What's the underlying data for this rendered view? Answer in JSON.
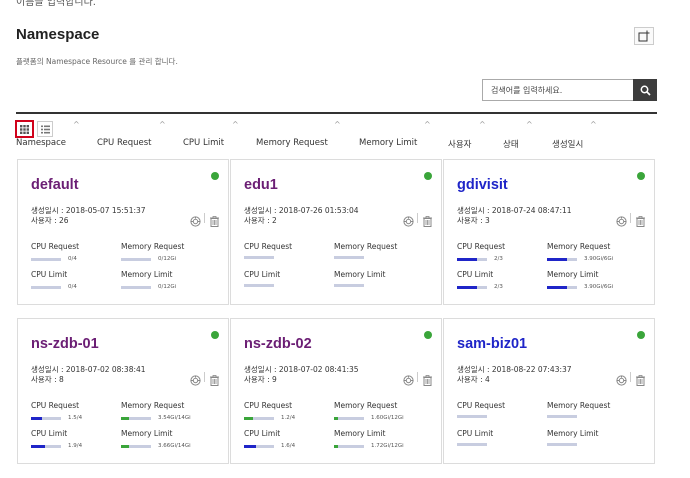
{
  "page": {
    "top_text": "이름을 입력합니다.",
    "title": "Namespace",
    "subtitle": "플랫폼의 Namespace Resource 를 관리 합니다.",
    "search_placeholder": "검색어를 입력하세요."
  },
  "colors": {
    "name_purple": "#6b1e74",
    "name_blue": "#1f25c8",
    "bar_blue": "#1f25c8",
    "bar_green": "#3aa53a",
    "track": "#c8cde0",
    "status_dot": "#3aa53a",
    "view_highlight": "#d0021b"
  },
  "icons": {
    "add": "add-namespace-icon",
    "search": "search-icon",
    "grid_view": "grid-view-icon",
    "list_view": "list-view-icon",
    "settings": "gauge-settings-icon",
    "delete": "trash-icon"
  },
  "sort_columns": [
    {
      "label": "Namespace",
      "caret": "^"
    },
    {
      "label": "CPU Request",
      "caret": "^"
    },
    {
      "label": "CPU Limit",
      "caret": "^"
    },
    {
      "label": "Memory Request",
      "caret": "^"
    },
    {
      "label": "Memory Limit",
      "caret": "^"
    },
    {
      "label": "사용자",
      "caret": "^"
    },
    {
      "label": "상태",
      "caret": "^"
    },
    {
      "label": "생성일시",
      "caret": "^"
    }
  ],
  "metric_labels": {
    "cpu_request": "CPU Request",
    "memory_request": "Memory Request",
    "cpu_limit": "CPU Limit",
    "memory_limit": "Memory Limit"
  },
  "cards": [
    {
      "name": "default",
      "name_color": "#6b1e74",
      "created": "생성일시 : 2018-05-07 15:51:37",
      "users": "사용자 : 26",
      "cpu_request": {
        "text": "0/4",
        "ratio": 0.0,
        "color": "#1f25c8"
      },
      "memory_request": {
        "text": "0/12Gi",
        "ratio": 0.0,
        "color": "#3aa53a"
      },
      "cpu_limit": {
        "text": "0/4",
        "ratio": 0.0,
        "color": "#1f25c8"
      },
      "memory_limit": {
        "text": "0/12Gi",
        "ratio": 0.0,
        "color": "#3aa53a"
      }
    },
    {
      "name": "edu1",
      "name_color": "#6b1e74",
      "created": "생성일시 : 2018-07-26 01:53:04",
      "users": "사용자 : 2",
      "cpu_request": {
        "text": "",
        "ratio": 0.0,
        "color": "#1f25c8"
      },
      "memory_request": {
        "text": "",
        "ratio": 0.0,
        "color": "#3aa53a"
      },
      "cpu_limit": {
        "text": "",
        "ratio": 0.0,
        "color": "#1f25c8"
      },
      "memory_limit": {
        "text": "",
        "ratio": 0.0,
        "color": "#3aa53a"
      }
    },
    {
      "name": "gdivisit",
      "name_color": "#1f25c8",
      "created": "생성일시 : 2018-07-24 08:47:11",
      "users": "사용자 : 3",
      "cpu_request": {
        "text": "2/3",
        "ratio": 0.67,
        "color": "#1f25c8"
      },
      "memory_request": {
        "text": "3.90Gi/6Gi",
        "ratio": 0.65,
        "color": "#1f25c8"
      },
      "cpu_limit": {
        "text": "2/3",
        "ratio": 0.67,
        "color": "#1f25c8"
      },
      "memory_limit": {
        "text": "3.90Gi/6Gi",
        "ratio": 0.65,
        "color": "#1f25c8"
      }
    },
    {
      "name": "ns-zdb-01",
      "name_color": "#6b1e74",
      "created": "생성일시 : 2018-07-02 08:38:41",
      "users": "사용자 : 8",
      "cpu_request": {
        "text": "1.5/4",
        "ratio": 0.375,
        "color": "#1f25c8"
      },
      "memory_request": {
        "text": "3.54Gi/14Gi",
        "ratio": 0.25,
        "color": "#3aa53a"
      },
      "cpu_limit": {
        "text": "1.9/4",
        "ratio": 0.475,
        "color": "#1f25c8"
      },
      "memory_limit": {
        "text": "3.66Gi/14Gi",
        "ratio": 0.26,
        "color": "#3aa53a"
      }
    },
    {
      "name": "ns-zdb-02",
      "name_color": "#6b1e74",
      "created": "생성일시 : 2018-07-02 08:41:35",
      "users": "사용자 : 9",
      "cpu_request": {
        "text": "1.2/4",
        "ratio": 0.3,
        "color": "#3aa53a"
      },
      "memory_request": {
        "text": "1.60Gi/12Gi",
        "ratio": 0.13,
        "color": "#3aa53a"
      },
      "cpu_limit": {
        "text": "1.6/4",
        "ratio": 0.4,
        "color": "#1f25c8"
      },
      "memory_limit": {
        "text": "1.72Gi/12Gi",
        "ratio": 0.14,
        "color": "#3aa53a"
      }
    },
    {
      "name": "sam-biz01",
      "name_color": "#1f25c8",
      "created": "생성일시 : 2018-08-22 07:43:37",
      "users": "사용자 : 4",
      "cpu_request": {
        "text": "",
        "ratio": 0.0,
        "color": "#1f25c8"
      },
      "memory_request": {
        "text": "",
        "ratio": 0.0,
        "color": "#3aa53a"
      },
      "cpu_limit": {
        "text": "",
        "ratio": 0.0,
        "color": "#1f25c8"
      },
      "memory_limit": {
        "text": "",
        "ratio": 0.0,
        "color": "#3aa53a"
      }
    }
  ]
}
